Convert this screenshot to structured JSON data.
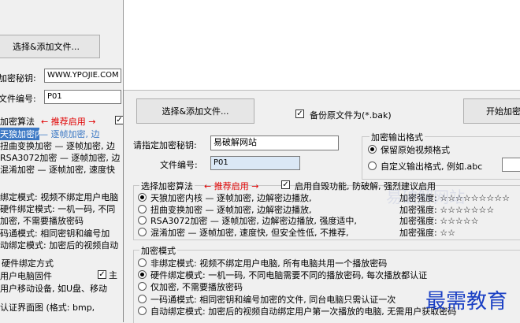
{
  "back": {
    "add_file_button": "选择&添加文件...",
    "key_label": "加密秘钥:",
    "key_value": "WWW.YPOJIE.COM",
    "number_label": "文件编号:",
    "number_value": "P01",
    "algo_title": "加密算法",
    "recommend": "← 推荐启用 →",
    "algo_items": [
      "天狼加密内核 — 逐帧加密, 边",
      "扭曲变换加密 — 逐帧加密, 边",
      "RSA3072加密 — 逐帧加密, 边",
      "混淆加密 — 逐帧加密, 速度快"
    ],
    "mode_items": [
      "绑定模式: 视频不绑定用户电脑",
      "硬件绑定模式: 一机一码, 不同",
      "加密, 不需要播放密码",
      "码通模式: 相同密钥和编号加",
      "动绑定模式: 加密后的视频自动"
    ],
    "hw_title": "硬件绑定方式",
    "hw_item": "用户电脑固件",
    "usb_item": "用户移动设备, 如U盘、移动",
    "auth_image": "认证界面图 (格式: bmp,",
    "hw_check": "主"
  },
  "front": {
    "add_file_button": "选择&添加文件...",
    "backup_label": "备份原文件为(*.bak)",
    "start_button": "开始加密",
    "key_label": "请指定加密秘钥:",
    "key_value": "易破解网站",
    "number_label": "文件编号:",
    "number_value": "P01",
    "output_title": "加密输出格式",
    "output_keep": "保留原始视频格式",
    "output_custom": "自定义输出格式, 例如.abc",
    "algo_title": "选择加密算法",
    "recommend": "← 推荐启用 →",
    "self_destroy": "启用自毁功能, 防破解, 强烈建议启用",
    "algorithms": [
      {
        "text": "天狼加密内核 — 逐帧加密, 边解密边播放,",
        "strength": "加密强度: ☆☆☆☆☆☆☆☆☆"
      },
      {
        "text": "扭曲变换加密 — 逐帧加密, 边解密边播放,",
        "strength": "加密强度: ☆☆☆☆☆☆☆"
      },
      {
        "text": "RSA3072加密 — 逐帧加密, 边解密边播放, 强度适中,",
        "strength": "加密强度: ☆☆☆☆☆"
      },
      {
        "text": "混淆加密 — 逐帧加密, 速度快, 但安全性低, 不推荐,",
        "strength": "加密强度: ☆☆"
      }
    ],
    "mode_title": "加密模式",
    "modes": [
      "非绑定模式: 视频不绑定用户电脑, 所有电脑共用一个播放密码",
      "硬件绑定模式: 一机一码, 不同电脑需要不同的播放密码, 每次播放都认证",
      "仅加密, 不需要播放密码",
      "一码通模式: 相同密钥和编号加密的文件, 同台电脑只需认证一次",
      "自动绑定模式: 加密后的视频自动绑定用户第一次播放的电脑, 无需用户获取密码"
    ]
  },
  "watermark": "最需教育",
  "watermark_faint": "易破解网站",
  "colors": {
    "accent": "#0000c8",
    "recommend": "#e00000"
  }
}
